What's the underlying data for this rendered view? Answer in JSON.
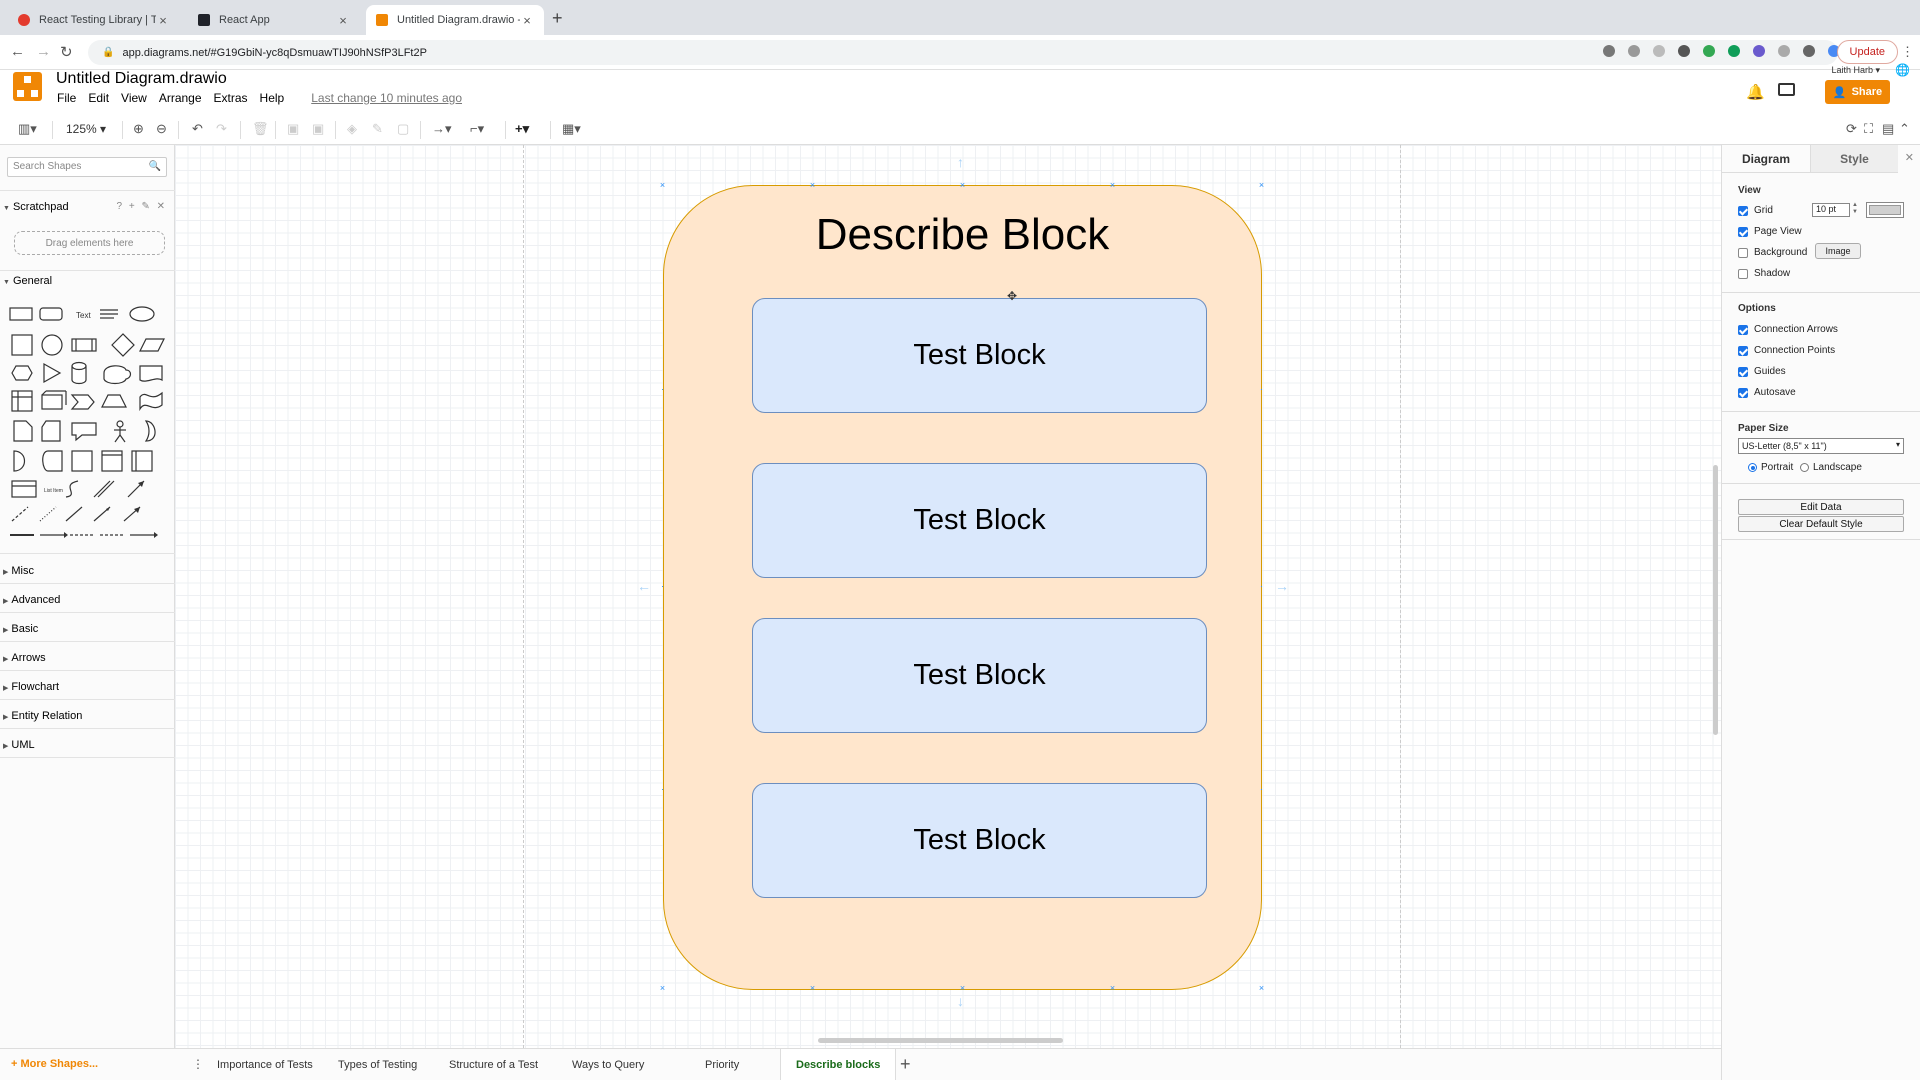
{
  "browser": {
    "tabs": [
      {
        "title": "React Testing Library | Testing",
        "favicon_color": "#e33b2e",
        "active": false
      },
      {
        "title": "React App",
        "favicon_color": "#20232a",
        "active": false
      },
      {
        "title": "Untitled Diagram.drawio - diag",
        "favicon_color": "#f08705",
        "active": true
      }
    ],
    "new_tab_label": "+",
    "url": "app.diagrams.net/#G19GbiN-yc8qDsmuawTIJ90hNSfP3LFt2P",
    "update_label": "Update"
  },
  "app": {
    "title": "Untitled Diagram.drawio",
    "menu": [
      "File",
      "Edit",
      "View",
      "Arrange",
      "Extras",
      "Help"
    ],
    "last_change": "Last change 10 minutes ago",
    "user": "Laith Harb",
    "share_label": "Share",
    "accent": "#f08705"
  },
  "toolbar": {
    "zoom": "125%"
  },
  "sidebar": {
    "search_placeholder": "Search Shapes",
    "scratchpad_label": "Scratchpad",
    "scratchpad_tools": "? + ✎ ✕",
    "drop_hint": "Drag elements here",
    "general_label": "General",
    "shape_text_label": "Text",
    "shape_list_label": "List Item",
    "sections": [
      "Misc",
      "Advanced",
      "Basic",
      "Arrows",
      "Flowchart",
      "Entity Relation",
      "UML"
    ],
    "more_shapes": "+ More Shapes..."
  },
  "diagram": {
    "container_title": "Describe Block",
    "blocks": [
      "Test Block",
      "Test Block",
      "Test Block",
      "Test Block"
    ],
    "container_fill": "#ffe6cc",
    "container_stroke": "#d79b00",
    "block_fill": "#dae8fc",
    "block_stroke": "#6c8ebf"
  },
  "format_panel": {
    "tabs": [
      "Diagram",
      "Style"
    ],
    "view_label": "View",
    "grid_label": "Grid",
    "grid_size": "10 pt",
    "page_view_label": "Page View",
    "background_label": "Background",
    "image_button": "Image",
    "shadow_label": "Shadow",
    "options_label": "Options",
    "options": [
      "Connection Arrows",
      "Connection Points",
      "Guides",
      "Autosave"
    ],
    "paper_size_label": "Paper Size",
    "paper_size": "US-Letter (8,5\" x 11\")",
    "portrait_label": "Portrait",
    "landscape_label": "Landscape",
    "edit_data": "Edit Data",
    "clear_default_style": "Clear Default Style"
  },
  "pages": {
    "tabs": [
      "Importance of Tests",
      "Types of Testing",
      "Structure of a Test",
      "Ways to Query",
      "Priority",
      "Describe blocks"
    ],
    "active": "Describe blocks"
  }
}
